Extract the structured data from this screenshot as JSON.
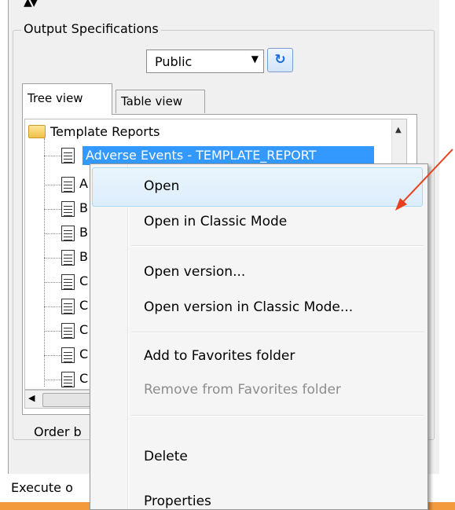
{
  "group": {
    "title": "Output Specifications"
  },
  "filter": {
    "selected": "Public",
    "refresh_icon": "refresh-icon"
  },
  "tabs": [
    {
      "label": "Tree view",
      "active": true
    },
    {
      "label": "Table view",
      "active": false
    }
  ],
  "tree": {
    "root_label": "Template Reports",
    "selected_item": "Adverse Events - TEMPLATE_REPORT",
    "partial_items": [
      "A",
      "B",
      "B",
      "B",
      "C",
      "C",
      "C",
      "C",
      "C"
    ]
  },
  "footer": {
    "order_label": "Order b",
    "execute_label": "Execute o"
  },
  "context_menu": {
    "items": [
      {
        "label": "Open",
        "enabled": true,
        "highlighted": true
      },
      {
        "label": "Open in Classic Mode",
        "enabled": true
      },
      {
        "label": "Open version...",
        "enabled": true
      },
      {
        "label": "Open version in Classic Mode...",
        "enabled": true
      },
      {
        "label": "Add to Favorites folder",
        "enabled": true
      },
      {
        "label": "Remove from Favorites folder",
        "enabled": false
      },
      {
        "label": "Delete",
        "enabled": true
      },
      {
        "label": "Properties",
        "enabled": true
      }
    ]
  },
  "colors": {
    "selection": "#3399ff",
    "annotation_arrow": "#e8401c",
    "footer_bar": "#f39a3c"
  }
}
